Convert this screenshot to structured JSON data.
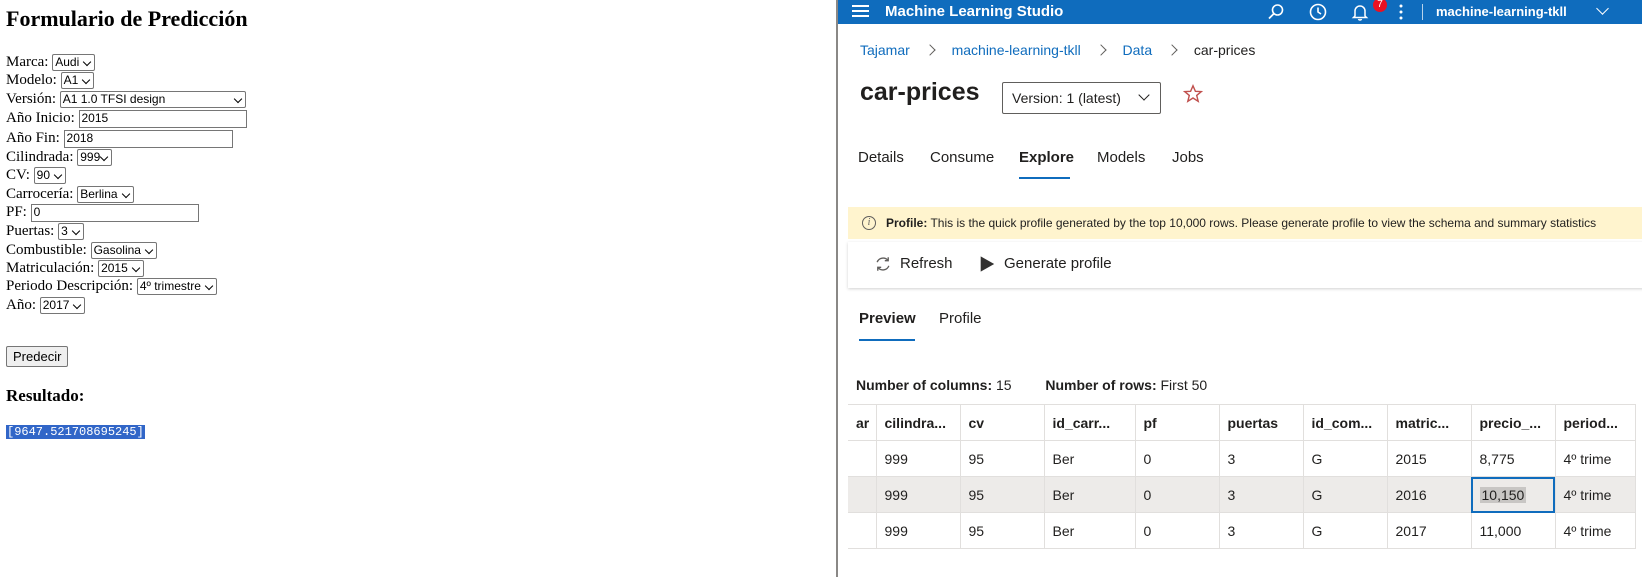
{
  "form": {
    "title": "Formulario de Predicción",
    "fields": [
      {
        "label": "Marca:",
        "value": "Audi"
      },
      {
        "label": "Modelo:",
        "value": "A1"
      },
      {
        "label": "Versión:",
        "value": "A1 1.0 TFSI design"
      },
      {
        "label": "Año Inicio:",
        "value": "2015"
      },
      {
        "label": "Año Fin:",
        "value": "2018"
      },
      {
        "label": "Cilindrada:",
        "value": "999"
      },
      {
        "label": "CV:",
        "value": "90"
      },
      {
        "label": "Carrocería:",
        "value": "Berlina"
      },
      {
        "label": "PF:",
        "value": "0"
      },
      {
        "label": "Puertas:",
        "value": "3"
      },
      {
        "label": "Combustible:",
        "value": "Gasolina"
      },
      {
        "label": "Matriculación:",
        "value": "2015"
      },
      {
        "label": "Periodo Descripción:",
        "value": "4º trimestre"
      },
      {
        "label": "Año:",
        "value": "2017"
      }
    ],
    "submit_label": "Predecir",
    "result_heading": "Resultado:",
    "result_value": "[9647.521708695245]"
  },
  "studio": {
    "app_name": "Machine Learning Studio",
    "notification_count": "7",
    "workspace": "machine-learning-tkll",
    "breadcrumb": [
      "Tajamar",
      "machine-learning-tkll",
      "Data",
      "car-prices"
    ],
    "dataset_title": "car-prices",
    "version_label": "Version: 1 (latest)",
    "tabs": [
      "Details",
      "Consume",
      "Explore",
      "Models",
      "Jobs"
    ],
    "active_tab": "Explore",
    "info": {
      "bold": "Profile:",
      "text": " This is the quick profile generated by the top 10,000 rows. Please generate profile to view the schema and summary statistics"
    },
    "commands": {
      "refresh": "Refresh",
      "generate": "Generate profile"
    },
    "subtabs": [
      "Preview",
      "Profile"
    ],
    "active_subtab": "Preview",
    "stats": {
      "columns_label": "Number of columns:",
      "columns_value": "15",
      "rows_label": "Number of rows:",
      "rows_value": "First 50"
    },
    "table": {
      "headers": [
        "ar",
        "cilindra...",
        "cv",
        "id_carr...",
        "pf",
        "puertas",
        "id_com...",
        "matric...",
        "precio_...",
        "period..."
      ],
      "rows": [
        [
          "",
          "999",
          "95",
          "Ber",
          "0",
          "3",
          "G",
          "2015",
          "8,775",
          "4º trime"
        ],
        [
          "",
          "999",
          "95",
          "Ber",
          "0",
          "3",
          "G",
          "2016",
          "10,150",
          "4º trime"
        ],
        [
          "",
          "999",
          "95",
          "Ber",
          "0",
          "3",
          "G",
          "2017",
          "11,000",
          "4º trime"
        ]
      ]
    }
  }
}
